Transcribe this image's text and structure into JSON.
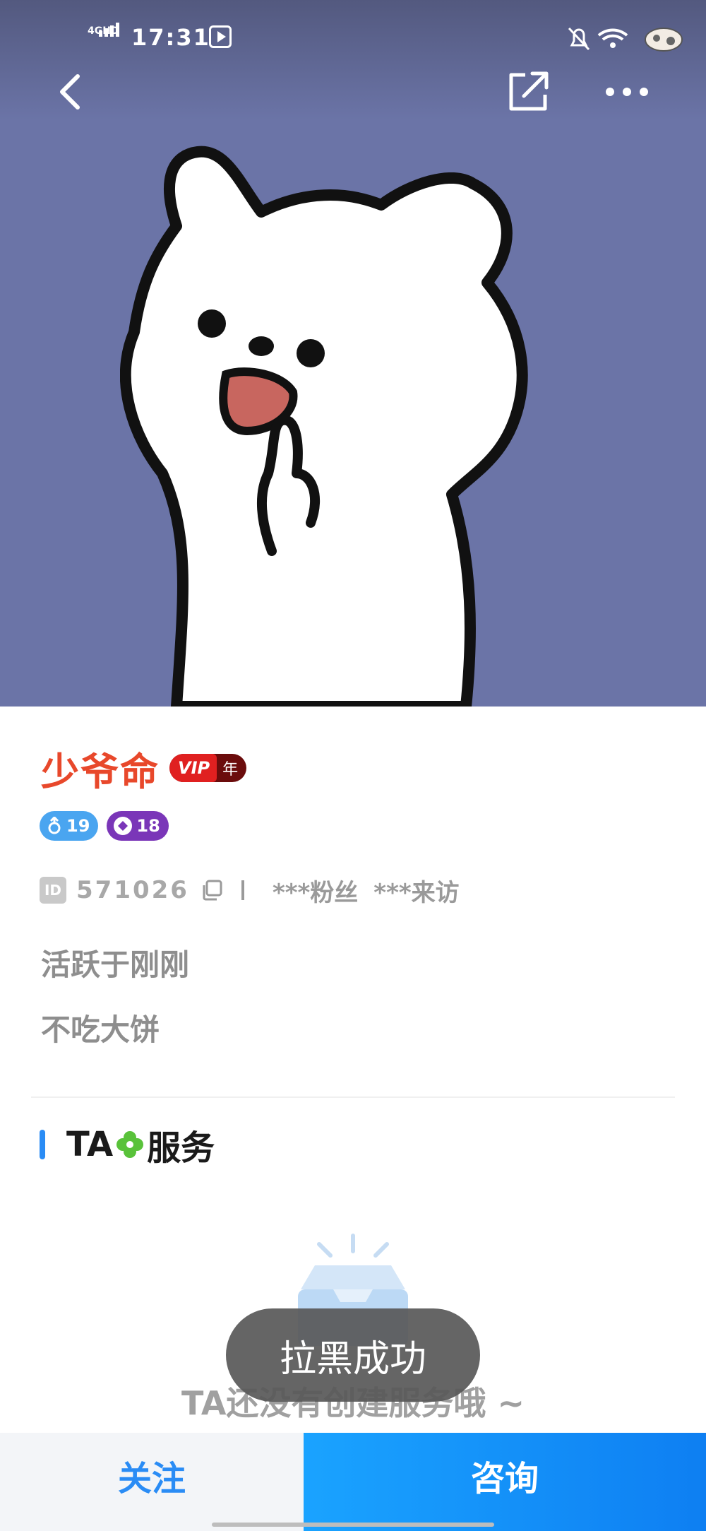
{
  "status_bar": {
    "network": "4GHD",
    "time": "17:31"
  },
  "profile": {
    "nickname": "少爷命",
    "vip_label": "VIP",
    "vip_term": "年",
    "gender_age": "19",
    "level": "18",
    "id_label": "ID",
    "id_value": "571026",
    "fans": "***粉丝",
    "visits": "***来访",
    "active_status": "活跃于刚刚",
    "bio": "不吃大饼"
  },
  "services": {
    "title_prefix": "TA",
    "title_suffix": "服务",
    "empty_text": "TA还没有创建服务哦 ~"
  },
  "toast": {
    "text": "拉黑成功"
  },
  "bottom_bar": {
    "follow_label": "关注",
    "consult_label": "咨询"
  },
  "colors": {
    "hero_bg": "#6b74a7",
    "nickname": "#e8482b",
    "accent_blue": "#2a8cf5",
    "vip_red": "#e02020"
  },
  "icons": [
    "back-arrow-icon",
    "share-icon",
    "more-icon",
    "copy-icon",
    "clover-icon",
    "empty-box-icon",
    "male-icon",
    "level-icon"
  ]
}
